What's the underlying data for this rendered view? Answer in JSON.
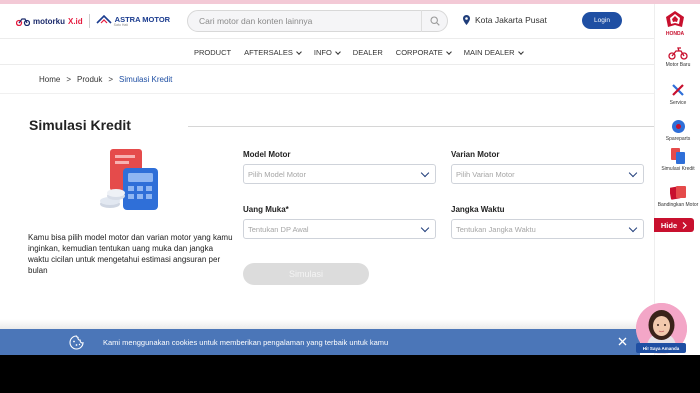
{
  "header": {
    "logo_motorku": "motorku",
    "logo_motorku_suffix": "X.id",
    "logo_astra": "ASTRA MOTOR",
    "logo_astra_sub": "Satu Hati",
    "search_placeholder": "Cari motor dan konten lainnya",
    "location": "Kota Jakarta Pusat",
    "login_label": "Login"
  },
  "nav": {
    "items": [
      {
        "label": "PRODUCT",
        "dropdown": false
      },
      {
        "label": "AFTERSALES",
        "dropdown": true
      },
      {
        "label": "INFO",
        "dropdown": true
      },
      {
        "label": "DEALER",
        "dropdown": false
      },
      {
        "label": "CORPORATE",
        "dropdown": true
      },
      {
        "label": "MAIN DEALER",
        "dropdown": true
      }
    ]
  },
  "breadcrumb": {
    "home": "Home",
    "sep": ">",
    "produk": "Produk",
    "current": "Simulasi Kredit"
  },
  "main": {
    "title": "Simulasi Kredit",
    "description": "Kamu bisa pilih model motor dan varian motor yang kamu inginkan, kemudian tentukan uang muka dan jangka waktu cicilan untuk mengetahui estimasi angsuran per bulan",
    "fields": {
      "model_label": "Model Motor",
      "model_placeholder": "Pilih Model Motor",
      "varian_label": "Varian Motor",
      "varian_placeholder": "Pilih Varian Motor",
      "dp_label": "Uang Muka*",
      "dp_placeholder": "Tentukan DP Awal",
      "tenor_label": "Jangka Waktu",
      "tenor_placeholder": "Tentukan Jangka Waktu"
    },
    "submit_label": "Simulasi"
  },
  "sidebar": {
    "items": [
      {
        "label": "Motor Baru"
      },
      {
        "label": "Service"
      },
      {
        "label": "Spareparts"
      },
      {
        "label": "Simulasi Kredit"
      },
      {
        "label": "Bandingkan Motor"
      }
    ],
    "hide_label": "Hide",
    "brand_label": "HONDA"
  },
  "cookie": {
    "text": "Kami menggunakan cookies untuk memberikan pengalaman yang terbaik untuk kamu"
  },
  "assistant": {
    "label": "Hi! Saya Amanda"
  },
  "colors": {
    "primary": "#1f4fa3",
    "honda_red": "#c8102e",
    "cookie_bar": "#4b76b8"
  }
}
